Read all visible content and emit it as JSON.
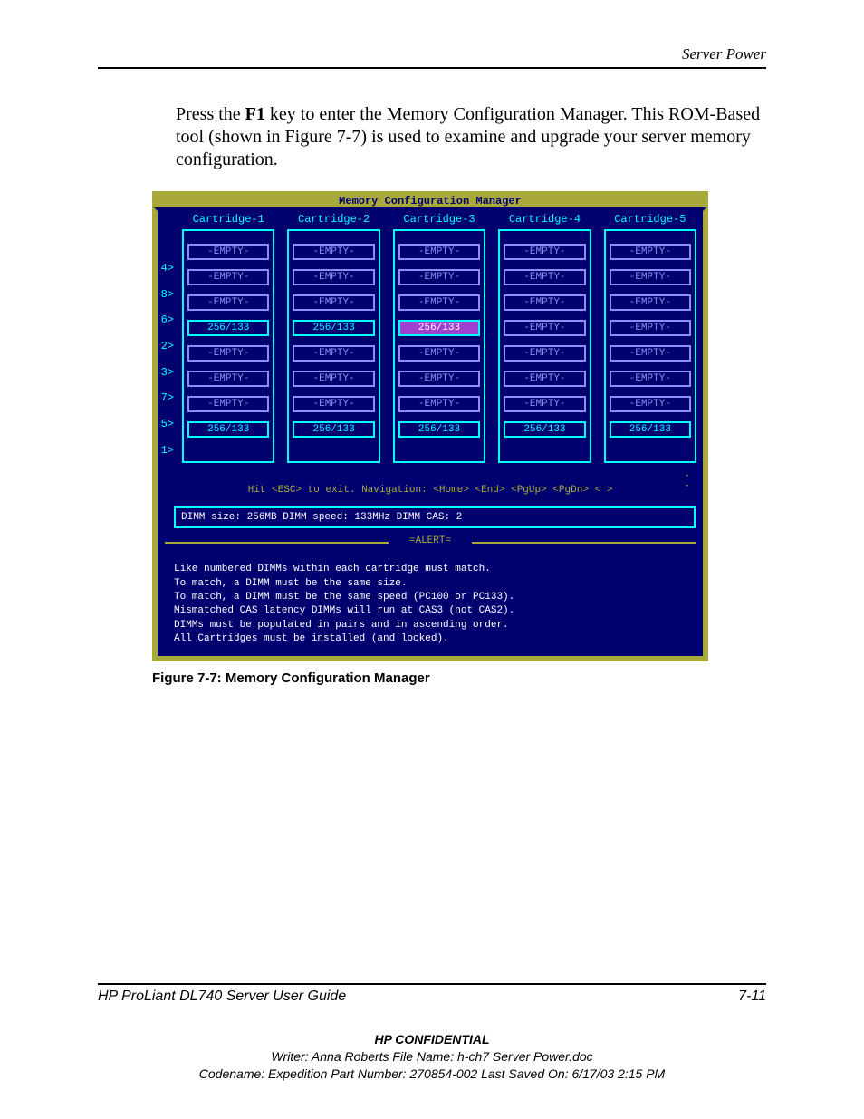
{
  "header": {
    "section": "Server Power"
  },
  "para": {
    "pre": "Press the ",
    "key": "F1",
    "post": " key to enter the Memory Configuration Manager. This ROM-Based tool (shown in Figure 7-7) is used to examine and upgrade your server memory configuration."
  },
  "shot": {
    "title": "Memory Configuration Manager",
    "cart_headers": [
      "Cartridge-1",
      "Cartridge-2",
      "Cartridge-3",
      "Cartridge-4",
      "Cartridge-5"
    ],
    "row_labels": [
      "4>",
      "8>",
      "6>",
      "2>",
      "3>",
      "7>",
      "5>",
      "1>"
    ],
    "rows": [
      [
        "-EMPTY-",
        "-EMPTY-",
        "-EMPTY-",
        "-EMPTY-",
        "-EMPTY-"
      ],
      [
        "-EMPTY-",
        "-EMPTY-",
        "-EMPTY-",
        "-EMPTY-",
        "-EMPTY-"
      ],
      [
        "-EMPTY-",
        "-EMPTY-",
        "-EMPTY-",
        "-EMPTY-",
        "-EMPTY-"
      ],
      [
        "256/133",
        "256/133",
        "256/133",
        "-EMPTY-",
        "-EMPTY-"
      ],
      [
        "-EMPTY-",
        "-EMPTY-",
        "-EMPTY-",
        "-EMPTY-",
        "-EMPTY-"
      ],
      [
        "-EMPTY-",
        "-EMPTY-",
        "-EMPTY-",
        "-EMPTY-",
        "-EMPTY-"
      ],
      [
        "-EMPTY-",
        "-EMPTY-",
        "-EMPTY-",
        "-EMPTY-",
        "-EMPTY-"
      ],
      [
        "256/133",
        "256/133",
        "256/133",
        "256/133",
        "256/133"
      ]
    ],
    "selected": {
      "row": 3,
      "col": 2
    },
    "nav_hint": "Hit <ESC> to exit. Navigation: <Home> <End> <PgUp> <PgDn> <  >",
    "dimm_info": "DIMM size:  256MB  DIMM speed:  133MHz  DIMM CAS: 2",
    "alert_label": "ALERT",
    "alert_lines": [
      "Like numbered DIMMs within each cartridge must match.",
      "To match, a DIMM must be the same size.",
      "To match, a DIMM must be the same speed (PC100 or PC133).",
      "Mismatched CAS latency DIMMs will run at CAS3 (not CAS2).",
      "DIMMs must be populated in pairs and in ascending order.",
      "All Cartridges must be installed (and locked)."
    ]
  },
  "caption": "Figure 7-7:  Memory Configuration Manager",
  "footer": {
    "guide": "HP ProLiant DL740 Server User Guide",
    "pageno": "7-11",
    "conf": "HP CONFIDENTIAL",
    "writer": "Writer: Anna Roberts File Name: h-ch7 Server Power.doc",
    "code": "Codename: Expedition Part Number: 270854-002 Last Saved On: 6/17/03 2:15 PM"
  }
}
